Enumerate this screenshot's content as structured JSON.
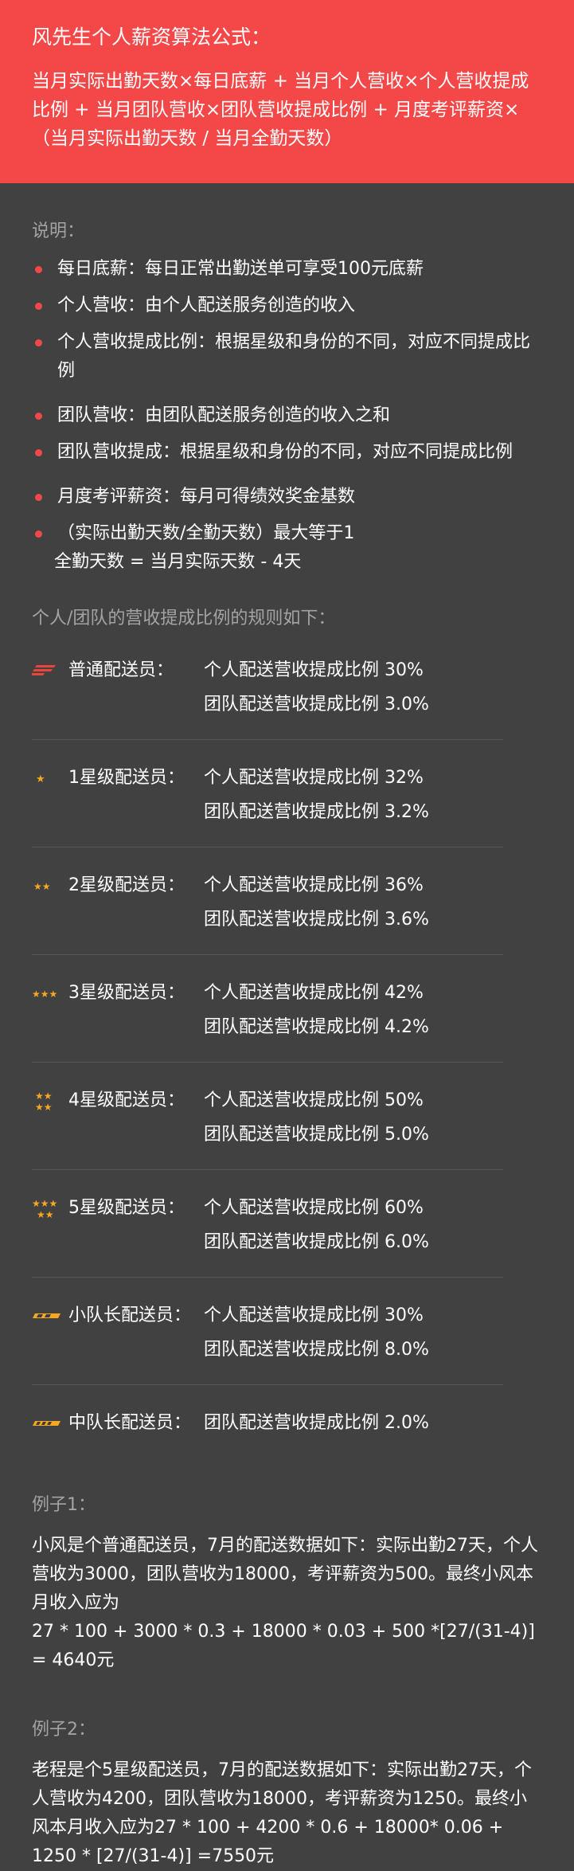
{
  "header": {
    "title": "风先生个人薪资算法公式：",
    "formula": "当月实际出勤天数×每日底薪 + 当月个人营收×个人营收提成比例 + 当月团队营收×团队营收提成比例 + 月度考评薪资×（当月实际出勤天数 / 当月全勤天数）"
  },
  "notes": {
    "label": "说明：",
    "items": [
      "每日底薪：每日正常出勤送单可享受100元底薪",
      "个人营收：由个人配送服务创造的收入",
      "个人营收提成比例：根据星级和身份的不同，对应不同提成比例",
      "团队营收：由团队配送服务创造的收入之和",
      "团队营收提成：根据星级和身份的不同，对应不同提成比例",
      "月度考评薪资：每月可得绩效奖金基数",
      "（实际出勤天数/全勤天数）最大等于1",
      "全勤天数 = 当月实际天数 - 4天"
    ]
  },
  "rules": {
    "label": "个人/团队的营收提成比例的规则如下：",
    "rows": [
      {
        "icon": "wing-icon",
        "name": "普通配送员：",
        "personal": "个人配送营收提成比例 30%",
        "team": "团队配送营收提成比例 3.0%"
      },
      {
        "icon": "star-1-icon",
        "name": "1星级配送员：",
        "personal": "个人配送营收提成比例 32%",
        "team": "团队配送营收提成比例 3.2%"
      },
      {
        "icon": "star-2-icon",
        "name": "2星级配送员：",
        "personal": "个人配送营收提成比例 36%",
        "team": "团队配送营收提成比例 3.6%"
      },
      {
        "icon": "star-3-icon",
        "name": "3星级配送员：",
        "personal": "个人配送营收提成比例 42%",
        "team": "团队配送营收提成比例 4.2%"
      },
      {
        "icon": "star-4-icon",
        "name": "4星级配送员：",
        "personal": "个人配送营收提成比例 50%",
        "team": "团队配送营收提成比例 5.0%"
      },
      {
        "icon": "star-5-icon",
        "name": "5星级配送员：",
        "personal": "个人配送营收提成比例 60%",
        "team": "团队配送营收提成比例 6.0%"
      },
      {
        "icon": "squad-badge-icon",
        "name": "小队长配送员：",
        "personal": "个人配送营收提成比例 30%",
        "team": "团队配送营收提成比例 8.0%"
      },
      {
        "icon": "captain-badge-icon",
        "name": "中队长配送员：",
        "personal": "团队配送营收提成比例 2.0%",
        "team": ""
      }
    ]
  },
  "example1": {
    "label": "例子1：",
    "text": "小风是个普通配送员，7月的配送数据如下：实际出勤27天，个人营收为3000，团队营收为18000，考评薪资为500。最终小风本月收入应为",
    "formula": "27 * 100 + 3000 * 0.3 + 18000 * 0.03 + 500 *[27/(31-4)] = 4640元"
  },
  "example2": {
    "label": "例子2：",
    "text": "老程是个5星级配送员，7月的配送数据如下：实际出勤27天，个人营收为4200，团队营收为18000，考评薪资为1250。最终小风本月收入应为27 * 100 + 4200 * 0.6 + 18000* 0.06 + 1250 * [27/(31-4)] =7550元"
  },
  "colors": {
    "header_bg": "#f44848",
    "page_bg": "#414141",
    "accent_bullet": "#f44848",
    "star": "#f7a823",
    "muted_label": "#a3a3a3"
  }
}
